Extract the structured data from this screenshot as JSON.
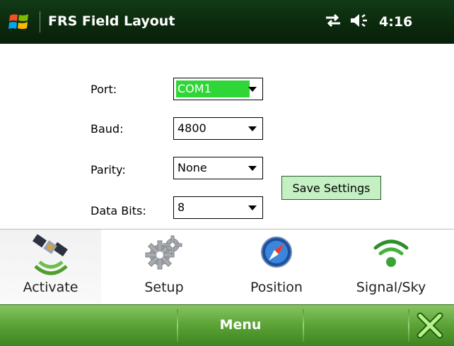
{
  "title_bar": {
    "title": "FRS Field Layout",
    "clock": "4:16",
    "icons": [
      "windows-start-icon",
      "connectivity-icon",
      "volume-icon"
    ]
  },
  "form": {
    "port": {
      "label": "Port:",
      "value": "COM1"
    },
    "baud": {
      "label": "Baud:",
      "value": "4800"
    },
    "parity": {
      "label": "Parity:",
      "value": "None"
    },
    "data_bits": {
      "label": "Data Bits:",
      "value": "8"
    },
    "save_label": "Save Settings"
  },
  "toolbar": {
    "items": [
      {
        "label": "Activate",
        "icon": "satellite-icon"
      },
      {
        "label": "Setup",
        "icon": "gears-icon"
      },
      {
        "label": "Position",
        "icon": "compass-icon"
      },
      {
        "label": "Signal/Sky",
        "icon": "signal-icon"
      }
    ]
  },
  "softkeys": {
    "menu_label": "Menu",
    "close_icon": "close-icon"
  },
  "colors": {
    "title_bg": "#0b2a0d",
    "softbar": "#5ba236",
    "selection": "#2fd637",
    "save_button": "#c4f0c4"
  }
}
